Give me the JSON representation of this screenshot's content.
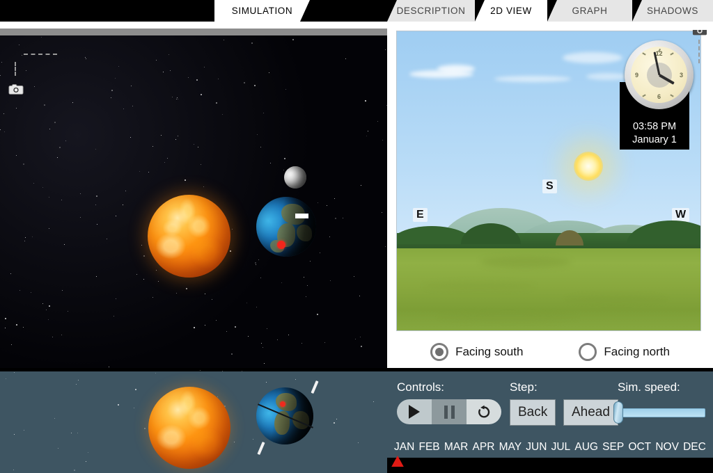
{
  "tabs": [
    {
      "label": "SIMULATION",
      "active": true
    },
    {
      "label": "DESCRIPTION",
      "active": false
    },
    {
      "label": "2D VIEW",
      "active": true
    },
    {
      "label": "GRAPH",
      "active": false
    },
    {
      "label": "SHADOWS",
      "active": false
    }
  ],
  "space_view": {
    "camera_icon": "camera-icon",
    "bodies": [
      "sun",
      "earth",
      "moon"
    ],
    "location_marker_color": "#f2261c"
  },
  "view2d": {
    "camera_icon": "camera-icon",
    "compass": {
      "east": "E",
      "south": "S",
      "west": "W"
    },
    "clock": {
      "time": "03:58 PM",
      "date": "January 1"
    },
    "facing_options": [
      {
        "label": "Facing south",
        "selected": true
      },
      {
        "label": "Facing north",
        "selected": false
      }
    ]
  },
  "controls": {
    "controls_label": "Controls:",
    "step_label": "Step:",
    "speed_label": "Sim. speed:",
    "play_icon": "play-icon",
    "pause_icon": "pause-icon",
    "reset_icon": "reset-icon",
    "step_back": "Back",
    "step_ahead": "Ahead",
    "speed_value": 0,
    "timeline_months": [
      "JAN",
      "FEB",
      "MAR",
      "APR",
      "MAY",
      "JUN",
      "JUL",
      "AUG",
      "SEP",
      "OCT",
      "NOV",
      "DEC"
    ],
    "timeline_marker_month": "JAN"
  },
  "colors": {
    "panel": "#3e5562",
    "accent_red": "#e11b15",
    "slider": "#9fd0ea",
    "sky": "#9fcdf2",
    "meadow": "#87a93f"
  }
}
